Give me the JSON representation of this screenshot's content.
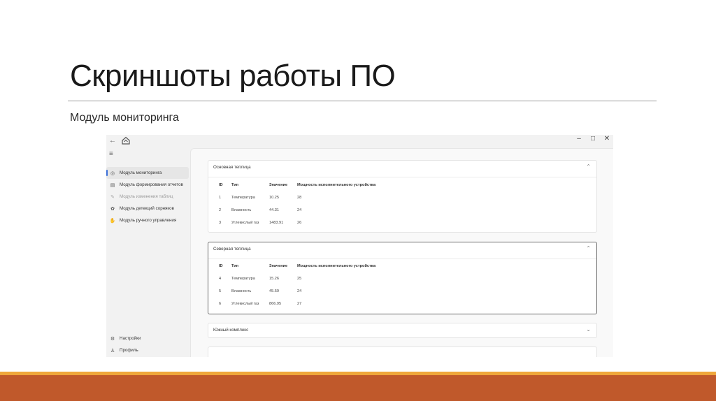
{
  "slide": {
    "title": "Скриншоты работы ПО",
    "subtitle": "Модуль мониторинга"
  },
  "colors": {
    "accent_orange": "#efa73b",
    "footer_rust": "#c0592b",
    "active_indicator": "#3a6fd8"
  },
  "app": {
    "titlebar": {
      "back_icon": "arrow-left-icon",
      "logo_icon": "app-logo-icon",
      "minimize": "–",
      "maximize": "□",
      "close": "✕"
    },
    "menu_icon": "≡",
    "sidebar": {
      "items": [
        {
          "label": "Модуль мониторинга",
          "icon": "◎",
          "active": true,
          "disabled": false
        },
        {
          "label": "Модуль формирования отчетов",
          "icon": "▤",
          "active": false,
          "disabled": false
        },
        {
          "label": "Модуль изменения таблиц",
          "icon": "✎",
          "active": false,
          "disabled": true
        },
        {
          "label": "Модуль детекций сорняков",
          "icon": "✿",
          "active": false,
          "disabled": false
        },
        {
          "label": "Модуль ручного управления",
          "icon": "✋",
          "active": false,
          "disabled": false
        }
      ],
      "bottom_items": [
        {
          "label": "Настройки",
          "icon": "⚙"
        },
        {
          "label": "Профиль",
          "icon": "♙"
        }
      ]
    },
    "table_headers": {
      "id": "ID",
      "type": "Тип",
      "value": "Значение",
      "power": "Мощность исполнительного устройства"
    },
    "panels": [
      {
        "title": "Основная теплица",
        "expanded": true,
        "rows": [
          {
            "id": "1",
            "type": "Температура",
            "value": "10.25",
            "power": "28"
          },
          {
            "id": "2",
            "type": "Влажность",
            "value": "44.31",
            "power": "24"
          },
          {
            "id": "3",
            "type": "Углекислый газ",
            "value": "1483.91",
            "power": "26"
          }
        ]
      },
      {
        "title": "Северная теплица",
        "expanded": true,
        "rows": [
          {
            "id": "4",
            "type": "Температура",
            "value": "15.26",
            "power": "25"
          },
          {
            "id": "5",
            "type": "Влажность",
            "value": "45.59",
            "power": "24"
          },
          {
            "id": "6",
            "type": "Углекислый газ",
            "value": "866.95",
            "power": "27"
          }
        ]
      },
      {
        "title": "Южный комплекс",
        "expanded": false,
        "rows": []
      }
    ]
  }
}
